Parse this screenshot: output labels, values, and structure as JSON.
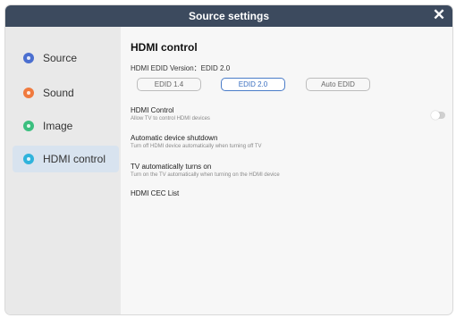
{
  "window": {
    "title": "Source settings",
    "close_glyph": "✕"
  },
  "sidebar": {
    "items": [
      {
        "label": "Source",
        "icon": "source-icon",
        "color": "#4b6fd0",
        "active": false
      },
      {
        "label": "Sound",
        "icon": "sound-icon",
        "color": "#f07a3e",
        "active": false
      },
      {
        "label": "Image",
        "icon": "image-icon",
        "color": "#3bbf7f",
        "active": false
      },
      {
        "label": "HDMI control",
        "icon": "hdmi-control-icon",
        "color": "#2fb3dc",
        "active": true
      }
    ]
  },
  "content": {
    "heading": "HDMI control",
    "edid_version": "HDMI EDID Version：EDID 2.0",
    "edid_buttons": [
      {
        "label": "EDID 1.4",
        "selected": false
      },
      {
        "label": "EDID 2.0",
        "selected": true
      },
      {
        "label": "Auto EDID",
        "selected": false
      }
    ],
    "settings": {
      "hdmi_control": {
        "title": "HDMI Control",
        "desc": "Allow TV to control HDMI devices",
        "enabled": false
      },
      "auto_shutdown": {
        "title": "Automatic device shutdown",
        "desc": "Turn off HDMI device automatically when turning off TV"
      },
      "auto_turn_on": {
        "title": "TV automatically turns on",
        "desc": "Turn on the TV automatically when turning on the HDMI device"
      },
      "cec_list": {
        "title": "HDMI CEC List"
      }
    }
  },
  "colors": {
    "titlebar": "#3c4a5e",
    "accent": "#4a7cc8",
    "active_nav": "#d8e3ef"
  }
}
